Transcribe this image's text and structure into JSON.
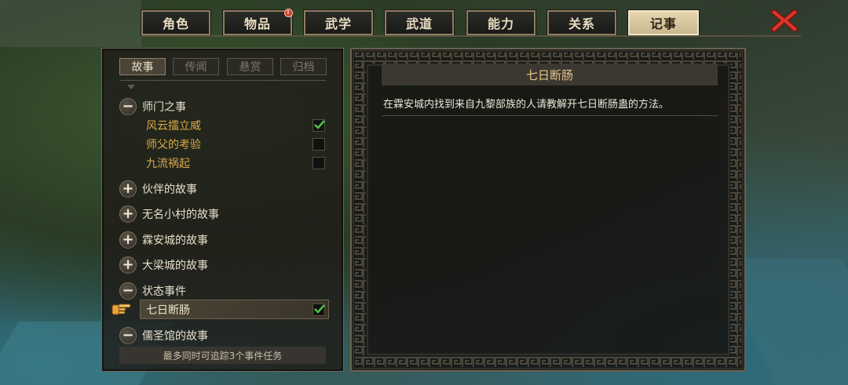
{
  "tabs": [
    {
      "label": "角色",
      "active": false
    },
    {
      "label": "物品",
      "active": false,
      "badge": "!"
    },
    {
      "label": "武学",
      "active": false
    },
    {
      "label": "武道",
      "active": false
    },
    {
      "label": "能力",
      "active": false
    },
    {
      "label": "关系",
      "active": false
    },
    {
      "label": "记事",
      "active": true
    }
  ],
  "close_icon": "red-x-icon",
  "subtabs": [
    {
      "label": "故事",
      "active": true
    },
    {
      "label": "传闻",
      "active": false
    },
    {
      "label": "悬赏",
      "active": false
    },
    {
      "label": "归档",
      "active": false
    }
  ],
  "groups": [
    {
      "label": "师门之事",
      "expanded": true,
      "toggle": "−",
      "items": [
        {
          "label": "风云擂立威",
          "checked": true
        },
        {
          "label": "师父的考验",
          "checked": false
        },
        {
          "label": "九流祸起",
          "checked": false
        }
      ]
    },
    {
      "label": "伙伴的故事",
      "expanded": false,
      "toggle": "+"
    },
    {
      "label": "无名小村的故事",
      "expanded": false,
      "toggle": "+"
    },
    {
      "label": "霖安城的故事",
      "expanded": false,
      "toggle": "+"
    },
    {
      "label": "大梁城的故事",
      "expanded": false,
      "toggle": "+"
    },
    {
      "label": "状态事件",
      "expanded": true,
      "toggle": "−",
      "items": [
        {
          "label": "七日断肠",
          "checked": true,
          "selected": true
        }
      ]
    },
    {
      "label": "儒圣馆的故事",
      "expanded": true,
      "toggle": "−"
    }
  ],
  "footer": "最多同时可追踪3个事件任务",
  "detail": {
    "title": "七日断肠",
    "description": "在霖安城内找到来自九黎部族的人请教解开七日断肠蛊的方法。"
  },
  "colors": {
    "accent_gold": "#d8a849",
    "check_green": "#4cc24c",
    "close_red": "#d9362a"
  }
}
